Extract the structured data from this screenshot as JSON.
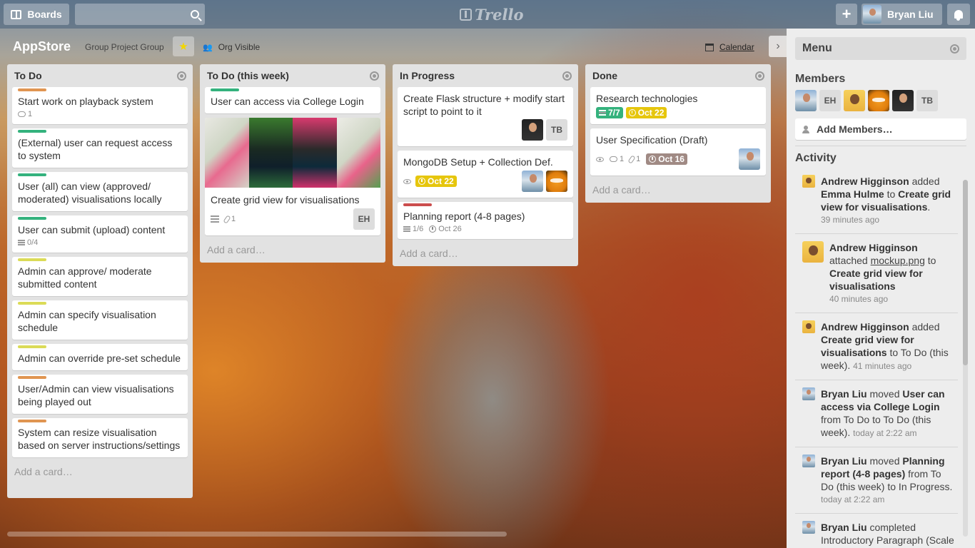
{
  "header": {
    "boards_label": "Boards",
    "search_placeholder": "",
    "logo_text": "Trello",
    "add_label": "+",
    "user_name": "Bryan Liu"
  },
  "board": {
    "title": "AppStore",
    "org": "Group Project Group",
    "visibility": "Org Visible",
    "calendar_label": "Calendar"
  },
  "lists": [
    {
      "title": "To Do",
      "add_card": "Add a card…",
      "cards": [
        {
          "title": "Start work on playback system",
          "label_color": "#e09551",
          "comments": "1"
        },
        {
          "title": "(External) user can request access to system",
          "label_color": "#34b27d"
        },
        {
          "title": "User (all) can view (approved/ moderated) visualisations locally",
          "label_color": "#34b27d"
        },
        {
          "title": "User can submit (upload) content",
          "label_color": "#34b27d",
          "checklist": "0/4"
        },
        {
          "title": "Admin can approve/ moderate submitted content",
          "label_color": "#dbdb57"
        },
        {
          "title": "Admin can specify visualisation schedule",
          "label_color": "#dbdb57"
        },
        {
          "title": "Admin can override pre-set schedule",
          "label_color": "#dbdb57"
        },
        {
          "title": "User/Admin can view visualisations being played out",
          "label_color": "#e09551"
        },
        {
          "title": "System can resize visualisation based on server instructions/settings",
          "label_color": "#e09551"
        }
      ]
    },
    {
      "title": "To Do (this week)",
      "add_card": "Add a card…",
      "cards": [
        {
          "title": "User can access via College Login",
          "label_color": "#34b27d"
        },
        {
          "title": "Create grid view for visualisations",
          "attachments": "1",
          "member": "EH"
        }
      ]
    },
    {
      "title": "In Progress",
      "add_card": "Add a card…",
      "cards": [
        {
          "title": "Create Flask structure + modify start script to point to it",
          "member": "TB"
        },
        {
          "title": "MongoDB Setup + Collection Def.",
          "due": "Oct 22",
          "due_color": "#e6c60d"
        },
        {
          "title": "Planning report (4-8 pages)",
          "label_color": "#cb4d4d",
          "checklist": "1/6",
          "date": "Oct 26"
        }
      ]
    },
    {
      "title": "Done",
      "add_card": "Add a card…",
      "cards": [
        {
          "title": "Research technologies",
          "checklist": "7/7",
          "checklist_color": "#34b27d",
          "due": "Oct 22",
          "due_color": "#e6c60d"
        },
        {
          "title": "User Specification (Draft)",
          "comments": "1",
          "attachments": "1",
          "due": "Oct 16",
          "due_color": "#a08a84"
        }
      ]
    }
  ],
  "sidebar": {
    "menu_title": "Menu",
    "members_title": "Members",
    "member_initials": [
      "EH",
      "TB"
    ],
    "add_members": "Add Members…",
    "activity_title": "Activity",
    "activity": [
      {
        "actor": "Andrew Higginson",
        "verb": "added",
        "obj1": "Emma Hulme",
        "mid": "to",
        "obj2": "Create grid view for visualisations",
        "tail": ".",
        "time": "39 minutes ago"
      },
      {
        "actor": "Andrew Higginson",
        "verb": "attached",
        "link": "mockup.png",
        "mid": "to",
        "obj2": "Create grid view for visualisations",
        "time": "40 minutes ago"
      },
      {
        "actor": "Andrew Higginson",
        "verb": "added",
        "obj1": "Create grid view for visualisations",
        "tail": "to To Do (this week).",
        "time": "41 minutes ago"
      },
      {
        "actor": "Bryan Liu",
        "verb": "moved",
        "obj1": "User can access via College Login",
        "tail": "from To Do to To Do (this week).",
        "time": "today at 2:22 am"
      },
      {
        "actor": "Bryan Liu",
        "verb": "moved",
        "obj1": "Planning report (4-8 pages)",
        "tail": "from To Do (this week) to In Progress.",
        "time": "today at 2:22 am"
      },
      {
        "actor": "Bryan Liu",
        "verb": "completed",
        "tail": "Introductory Paragraph (Scale & ..."
      }
    ]
  },
  "colors": {
    "header_bg": "#46607a",
    "list_bg": "#e2e2e2",
    "sidebar_bg": "#ededed",
    "label_green": "#34b27d",
    "label_yellow": "#dbdb57",
    "label_orange": "#e09551",
    "label_red": "#cb4d4d"
  },
  "icons": [
    "boards-icon",
    "search-icon",
    "trello-logo-icon",
    "plus-icon",
    "bell-icon",
    "star-icon",
    "org-visible-icon",
    "calendar-icon",
    "chevron-right-icon",
    "list-menu-icon",
    "comment-icon",
    "checklist-icon",
    "attachment-icon",
    "description-icon",
    "watch-icon",
    "clock-icon",
    "person-icon"
  ]
}
